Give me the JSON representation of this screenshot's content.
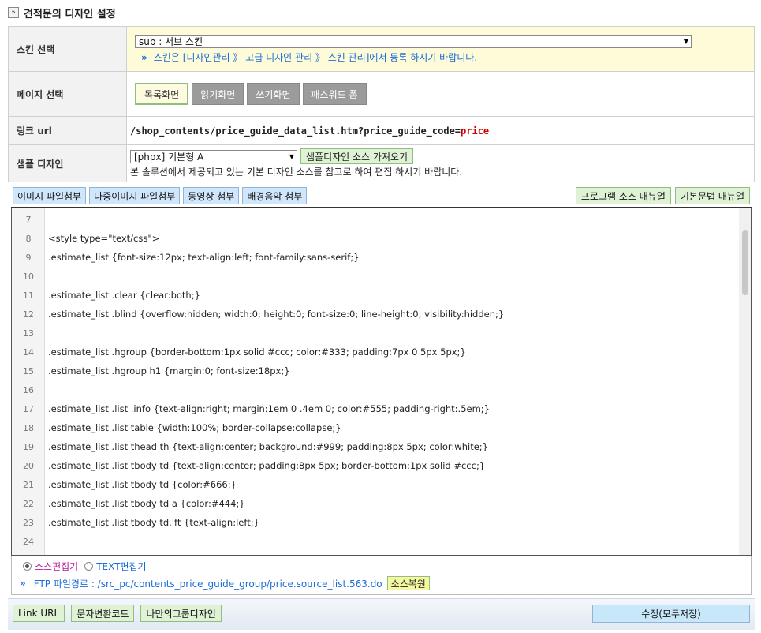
{
  "header": {
    "title": "견적문의 디자인 설정"
  },
  "skin": {
    "label": "스킨 선택",
    "selected": "sub : 서브 스킨",
    "hint": "스킨은 [디자인관리 》 고급 디자인 관리 》 스킨 관리]에서 등록 하시기 바랍니다."
  },
  "page": {
    "label": "페이지 선택",
    "tabs": [
      {
        "label": "목록화면"
      },
      {
        "label": "읽기화면"
      },
      {
        "label": "쓰기화면"
      },
      {
        "label": "패스워드 폼"
      }
    ]
  },
  "link": {
    "label": "링크 url",
    "path": "/shop_contents/price_guide_data_list.htm?price_guide_code=",
    "code": "price"
  },
  "sample": {
    "label": "샘플 디자인",
    "selected": "[phpx] 기본형 A",
    "fetch_button": "샘플디자인 소스 가져오기",
    "desc": "본 솔루션에서 제공되고 있는 기본 디자인 소스를 참고로 하여 편집 하시기 바랍니다."
  },
  "toolbar": {
    "image_attach": "이미지 파일첨부",
    "multi_image_attach": "다중이미지 파일첨부",
    "video_attach": "동영상 첨부",
    "bgm_attach": "배경음악 첨부",
    "program_manual": "프로그램 소스 매뉴얼",
    "syntax_manual": "기본문법 매뉴얼"
  },
  "editor": {
    "mode_source": "소스편집기",
    "mode_text": "TEXT편집기",
    "ftp_label": "FTP 파일경로 : /src_pc/contents_price_guide_group/price.source_list.563.do",
    "restore_button": "소스복원",
    "lines": [
      {
        "n": "7",
        "t": ""
      },
      {
        "n": "8",
        "t": "<style type=\"text/css\">"
      },
      {
        "n": "9",
        "t": ".estimate_list {font-size:12px; text-align:left; font-family:sans-serif;}"
      },
      {
        "n": "10",
        "t": ""
      },
      {
        "n": "11",
        "t": ".estimate_list .clear {clear:both;}"
      },
      {
        "n": "12",
        "t": ".estimate_list .blind {overflow:hidden; width:0; height:0; font-size:0; line-height:0; visibility:hidden;}"
      },
      {
        "n": "13",
        "t": ""
      },
      {
        "n": "14",
        "t": ".estimate_list .hgroup {border-bottom:1px solid #ccc; color:#333; padding:7px 0 5px 5px;}"
      },
      {
        "n": "15",
        "t": ".estimate_list .hgroup h1 {margin:0; font-size:18px;}"
      },
      {
        "n": "16",
        "t": ""
      },
      {
        "n": "17",
        "t": ".estimate_list .list .info {text-align:right; margin:1em 0 .4em 0; color:#555; padding-right:.5em;}"
      },
      {
        "n": "18",
        "t": ".estimate_list .list table {width:100%; border-collapse:collapse;}"
      },
      {
        "n": "19",
        "t": ".estimate_list .list thead th {text-align:center; background:#999; padding:8px 5px; color:white;}"
      },
      {
        "n": "20",
        "t": ".estimate_list .list tbody td {text-align:center; padding:8px 5px; border-bottom:1px solid #ccc;}"
      },
      {
        "n": "21",
        "t": ".estimate_list .list tbody td {color:#666;}"
      },
      {
        "n": "22",
        "t": ".estimate_list .list tbody td a {color:#444;}"
      },
      {
        "n": "23",
        "t": ".estimate_list .list tbody td.lft {text-align:left;}"
      },
      {
        "n": "24",
        "t": ""
      }
    ]
  },
  "footer": {
    "link_url": "Link URL",
    "char_convert": "문자변환코드",
    "my_group_design": "나만의그룹디자인",
    "save": "수정(모두저장)"
  }
}
